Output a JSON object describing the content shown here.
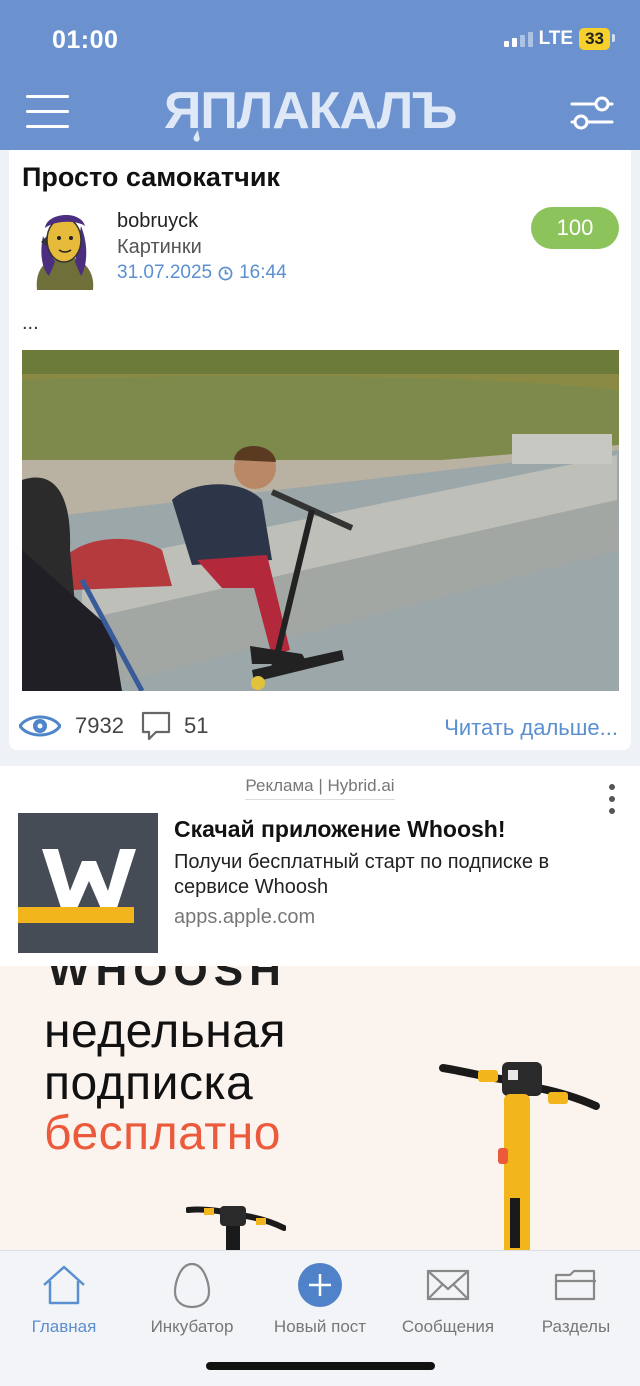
{
  "status_bar": {
    "time": "01:00",
    "network": "LTE",
    "battery": "33"
  },
  "header": {
    "logo_text": "ЯПЛАКАЛЪ",
    "menu_icon": "hamburger-icon",
    "filter_icon": "filter-sliders-icon"
  },
  "post": {
    "title": "Просто самокатчик",
    "author": "bobruyck",
    "category": "Картинки",
    "date": "31.07.2025",
    "time": "16:44",
    "rating": "100",
    "excerpt": "...",
    "views": "7932",
    "comments": "51",
    "read_more": "Читать дальше..."
  },
  "ad": {
    "label": "Реклама | Hybrid.ai",
    "title": "Скачай приложение Whoosh!",
    "text": "Получи бесплатный старт по подписке в сервисе Whoosh",
    "domain": "apps.apple.com",
    "banner_brand": "WHOOSH",
    "banner_lines": [
      "недельная",
      "подписка",
      "бесплатно"
    ]
  },
  "tabbar": {
    "items": [
      {
        "label": "Главная",
        "icon": "home-icon",
        "active": true
      },
      {
        "label": "Инкубатор",
        "icon": "egg-icon",
        "active": false
      },
      {
        "label": "Новый пост",
        "icon": "plus-circle-icon",
        "active": false
      },
      {
        "label": "Сообщения",
        "icon": "envelope-icon",
        "active": false
      },
      {
        "label": "Разделы",
        "icon": "folder-icon",
        "active": false
      }
    ]
  },
  "colors": {
    "header": "#6b92cf",
    "accent": "#5a8fd0",
    "rating": "#8cc35b",
    "banner_accent": "#ec5a3c"
  }
}
